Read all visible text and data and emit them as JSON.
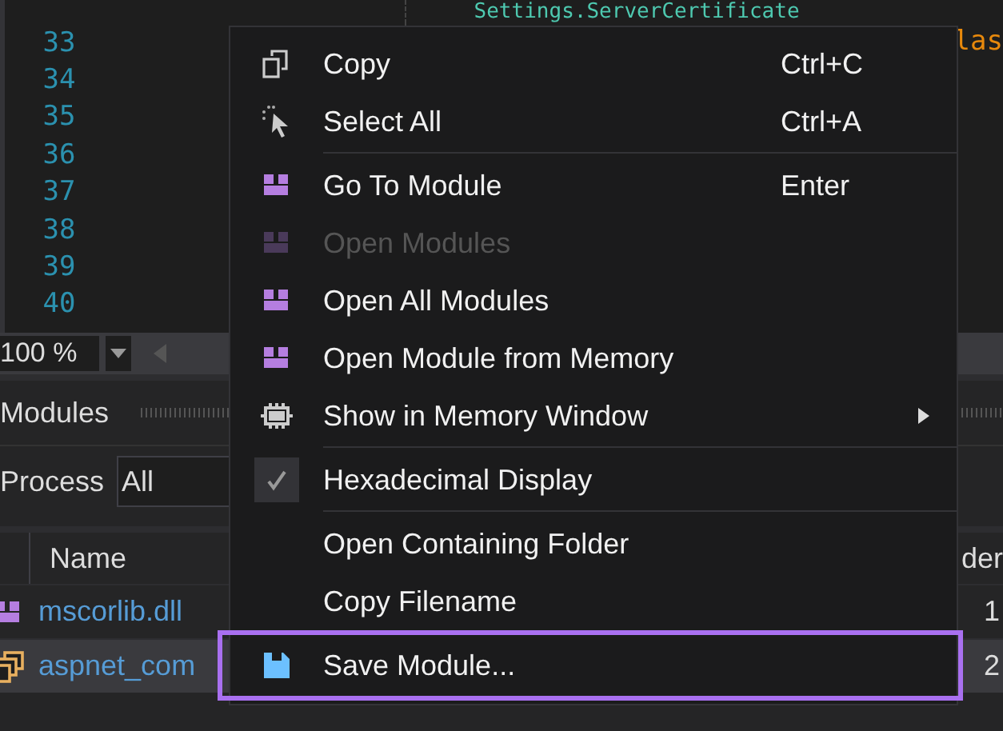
{
  "editor": {
    "lines": [
      {
        "code": "Settings.ServerCertificate",
        "kind": "code"
      },
      {
        "number": "33",
        "code": "las",
        "kind": "tail"
      },
      {
        "number": "34"
      },
      {
        "number": "35"
      },
      {
        "number": "36"
      },
      {
        "number": "37"
      },
      {
        "number": "38"
      },
      {
        "number": "39"
      },
      {
        "number": "40"
      }
    ],
    "zoom": "100 %"
  },
  "modules_panel": {
    "title": "Modules",
    "process_label": "Process",
    "process_value": "All",
    "columns": [
      "Name",
      "der"
    ],
    "rows": [
      {
        "kind": "module",
        "name": "mscorlib.dll",
        "column_2": "1",
        "selected": false
      },
      {
        "kind": "stack",
        "name": "aspnet_com",
        "column_2": "2",
        "selected": true
      }
    ]
  },
  "context_menu": {
    "items": [
      {
        "kind": "copy",
        "label": "Copy",
        "shortcut": "Ctrl+C",
        "disabled": false,
        "checked": false,
        "submenu": false,
        "highlighted": false
      },
      {
        "kind": "select",
        "label": "Select All",
        "shortcut": "Ctrl+A",
        "disabled": false,
        "checked": false,
        "submenu": false,
        "highlighted": false
      },
      {
        "kind": "separator"
      },
      {
        "kind": "module",
        "label": "Go To Module",
        "shortcut": "Enter",
        "disabled": false,
        "checked": false,
        "submenu": false,
        "highlighted": false
      },
      {
        "kind": "module",
        "label": "Open Modules",
        "disabled": true,
        "checked": false,
        "submenu": false,
        "highlighted": false
      },
      {
        "kind": "module",
        "label": "Open All Modules",
        "disabled": false,
        "checked": false,
        "submenu": false,
        "highlighted": false
      },
      {
        "kind": "module",
        "label": "Open Module from Memory",
        "disabled": false,
        "checked": false,
        "submenu": false,
        "highlighted": false
      },
      {
        "kind": "memory",
        "label": "Show in Memory Window",
        "disabled": false,
        "checked": false,
        "submenu": true,
        "highlighted": false
      },
      {
        "kind": "separator"
      },
      {
        "kind": "plain",
        "label": "Hexadecimal Display",
        "disabled": false,
        "checked": true,
        "submenu": false,
        "highlighted": false
      },
      {
        "kind": "separator"
      },
      {
        "kind": "plain",
        "label": "Open Containing Folder",
        "disabled": false,
        "checked": false,
        "submenu": false,
        "highlighted": false
      },
      {
        "kind": "plain",
        "label": "Copy Filename",
        "disabled": false,
        "checked": false,
        "submenu": false,
        "highlighted": false
      },
      {
        "kind": "separator"
      },
      {
        "kind": "save",
        "label": "Save Module...",
        "disabled": false,
        "checked": false,
        "submenu": false,
        "highlighted": true
      }
    ]
  }
}
